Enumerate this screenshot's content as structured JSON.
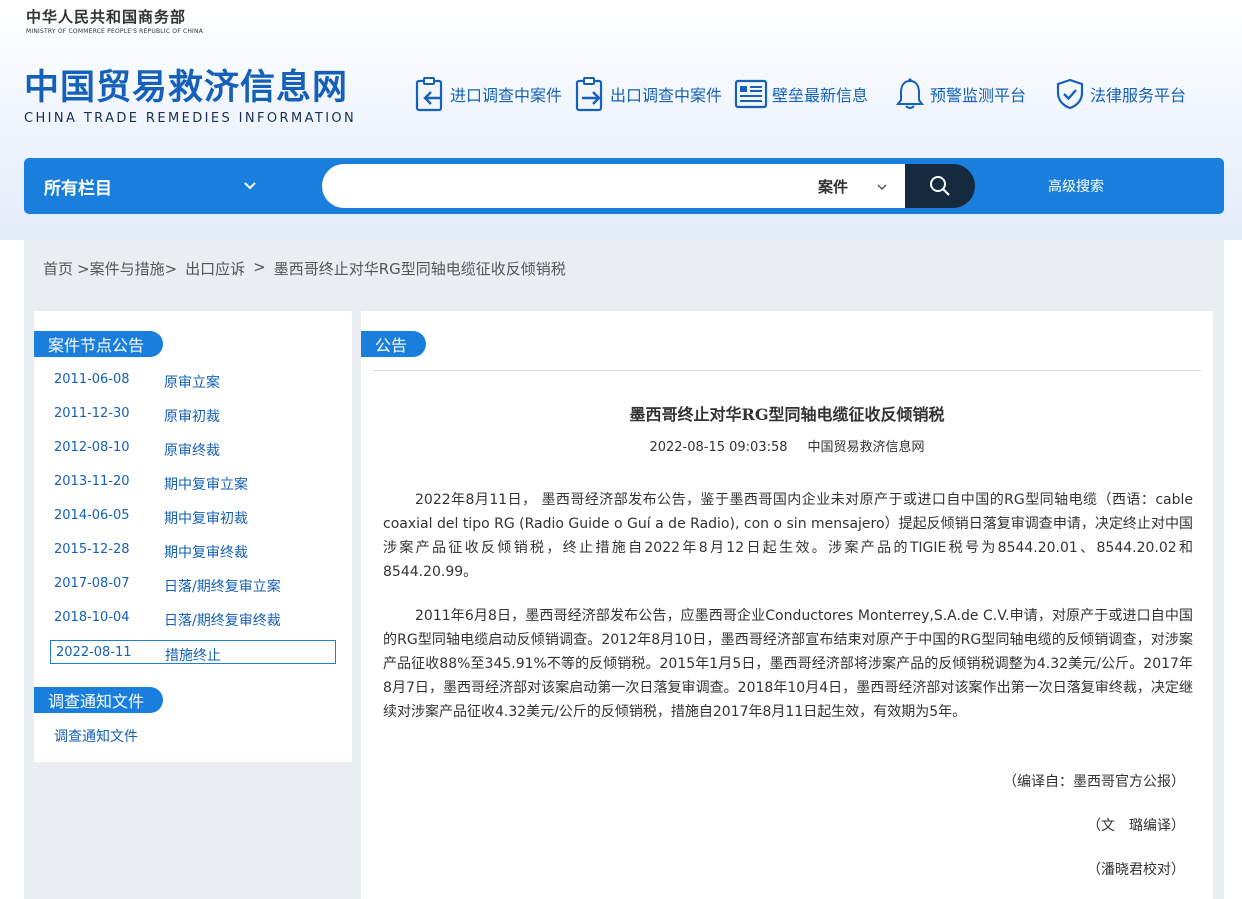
{
  "ministry": {
    "cn": "中华人民共和国商务部",
    "en": "MINISTRY OF COMMERCE PEOPLE'S REPUBLIC OF CHINA"
  },
  "logo": {
    "cn": "中国贸易救济信息网",
    "en": "CHINA TRADE REMEDIES INFORMATION"
  },
  "topnav": [
    {
      "label": "进口调查中案件",
      "icon": "import-doc-icon"
    },
    {
      "label": "出口调查中案件",
      "icon": "export-doc-icon"
    },
    {
      "label": "壁垒最新信息",
      "icon": "news-board-icon"
    },
    {
      "label": "预警监测平台",
      "icon": "bell-icon"
    },
    {
      "label": "法律服务平台",
      "icon": "shield-check-icon"
    }
  ],
  "search": {
    "category": "所有栏目",
    "type": "案件",
    "value": "",
    "advanced": "高级搜索"
  },
  "breadcrumb": [
    "首页",
    ">案件与措施>",
    "出口应诉",
    ">",
    "墨西哥终止对华RG型同轴电缆征收反倾销税"
  ],
  "sidebar": {
    "nodes_title": "案件节点公告",
    "nodes": [
      {
        "date": "2011-06-08",
        "label": "原审立案"
      },
      {
        "date": "2011-12-30",
        "label": "原审初裁"
      },
      {
        "date": "2012-08-10",
        "label": "原审终裁"
      },
      {
        "date": "2013-11-20",
        "label": "期中复审立案"
      },
      {
        "date": "2014-06-05",
        "label": "期中复审初裁"
      },
      {
        "date": "2015-12-28",
        "label": "期中复审终裁"
      },
      {
        "date": "2017-08-07",
        "label": "日落/期终复审立案"
      },
      {
        "date": "2018-10-04",
        "label": "日落/期终复审终裁"
      },
      {
        "date": "2022-08-11",
        "label": "措施终止"
      }
    ],
    "docs_title": "调查通知文件",
    "docs": [
      "调查通知文件"
    ]
  },
  "article": {
    "tag": "公告",
    "title": "墨西哥终止对华RG型同轴电缆征收反倾销税",
    "datetime": "2022-08-15 09:03:58",
    "source": "中国贸易救济信息网",
    "paragraphs": [
      "2022年8月11日， 墨西哥经济部发布公告，鉴于墨西哥国内企业未对原产于或进口自中国的RG型同轴电缆（西语：cable coaxial del tipo RG (Radio Guide o Guí a de Radio), con o sin mensajero）提起反倾销日落复审调查申请，决定终止对中国涉案产品征收反倾销税，终止措施自2022年8月12日起生效。涉案产品的TIGIE税号为8544.20.01、8544.20.02和8544.20.99。",
      "2011年6月8日，墨西哥经济部发布公告，应墨西哥企业Conductores Monterrey,S.A.de C.V.申请，对原产于或进口自中国的RG型同轴电缆启动反倾销调查。2012年8月10日，墨西哥经济部宣布结束对原产于中国的RG型同轴电缆的反倾销调查，对涉案产品征收88%至345.91%不等的反倾销税。2015年1月5日，墨西哥经济部将涉案产品的反倾销税调整为4.32美元/公斤。2017年8月7日，墨西哥经济部对该案启动第一次日落复审调查。2018年10月4日，墨西哥经济部对该案作出第一次日落复审终裁，决定继续对涉案产品征收4.32美元/公斤的反倾销税，措施自2017年8月11日起生效，有效期为5年。"
    ],
    "signatures": [
      "（编译自：墨西哥官方公报）",
      "（文　璐编译）",
      "（潘晓君校对）"
    ]
  },
  "colors": {
    "brand_blue": "#1a7fdc",
    "logo_blue": "#1560b8",
    "search_button": "#152a3f",
    "page_gray": "#eaeef3"
  }
}
